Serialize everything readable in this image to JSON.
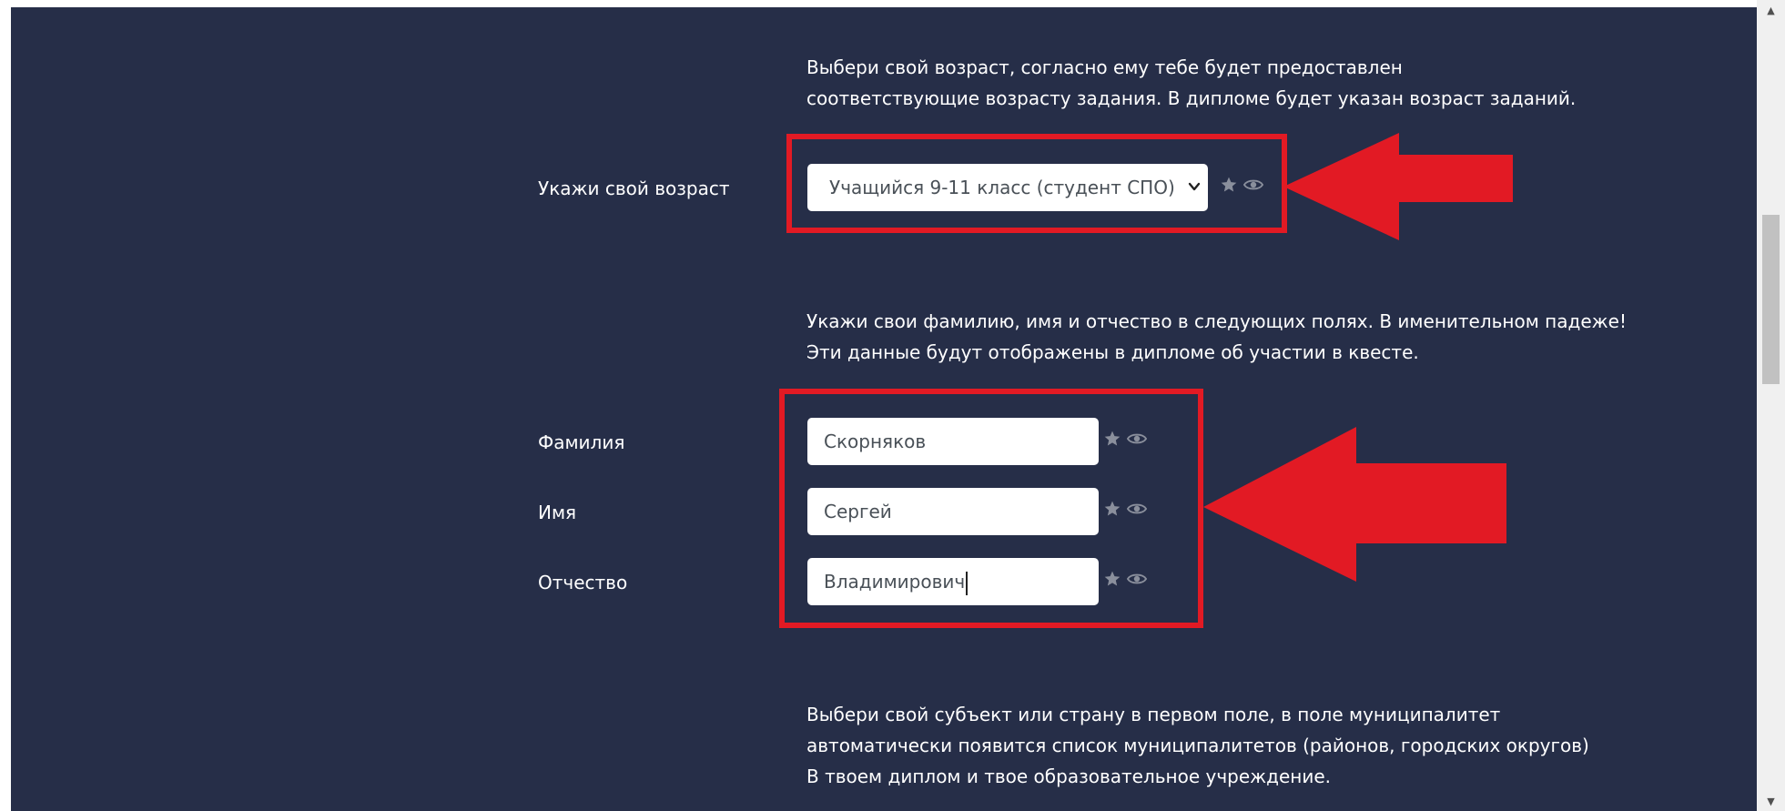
{
  "age_section": {
    "description_line1": "Выбери свой возраст, согласно ему тебе будет предоставлен",
    "description_line2": "соответствующие возрасту задания. В дипломе будет указан возраст заданий.",
    "label": "Укажи свой возраст",
    "selected_value": "Учащийся 9-11 класс (студент СПО)"
  },
  "name_section": {
    "description_line1": "Укажи свои фамилию, имя и отчество в следующих полях. В именительном падеже!",
    "description_line2": "Эти данные будут отображены в дипломе об участии в квесте.",
    "fields": [
      {
        "label": "Фамилия",
        "value": "Скорняков"
      },
      {
        "label": "Имя",
        "value": "Сергей"
      },
      {
        "label": "Отчество",
        "value": "Владимирович"
      }
    ]
  },
  "region_section": {
    "description_line1": "Выбери свой субъект или страну в первом поле, в поле муниципалитет",
    "description_line2": "автоматически появится список муниципалитетов (районов, городских округов)",
    "description_line3": "В твоем диплом и твое образовательное учреждение."
  },
  "icons": {
    "star": "star-icon",
    "eye": "eye-icon",
    "chevron": "chevron-down-icon"
  },
  "colors": {
    "background": "#262e48",
    "annotation_red": "#e21a24",
    "icon_gray": "#8a8f9c"
  }
}
